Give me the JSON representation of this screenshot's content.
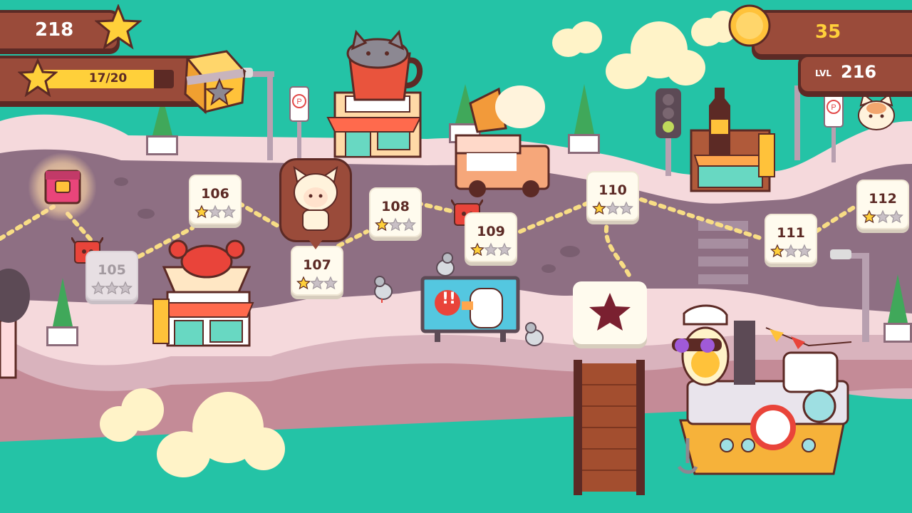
{
  "hud": {
    "star_total": "218",
    "progress_text": "17/20",
    "progress_fraction": 0.85,
    "coins": "35",
    "level_label": "LVL",
    "level_value": "216"
  },
  "levels": [
    {
      "num": "105",
      "stars": 0,
      "locked": true
    },
    {
      "num": "106",
      "stars": 1,
      "locked": false
    },
    {
      "num": "107",
      "stars": 1,
      "locked": false
    },
    {
      "num": "108",
      "stars": 1,
      "locked": false
    },
    {
      "num": "109",
      "stars": 1,
      "locked": false
    },
    {
      "num": "110",
      "stars": 1,
      "locked": false
    },
    {
      "num": "111",
      "stars": 1,
      "locked": false
    },
    {
      "num": "112",
      "stars": 1,
      "locked": false
    }
  ],
  "billboard_text": "!!",
  "colors": {
    "sea": "#24c3a6",
    "road": "#8e6f83",
    "sidewalk": "#f5d9dc",
    "hud_brown": "#9a4b3a",
    "star_gold": "#ffd03a"
  }
}
